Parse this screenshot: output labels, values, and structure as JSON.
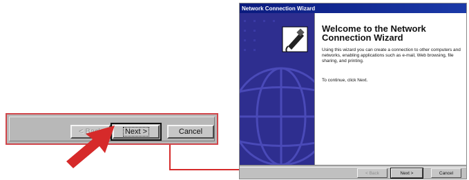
{
  "zoom_strip": {
    "back_label": "< Back",
    "next_label": "Next >",
    "cancel_label": "Cancel"
  },
  "wizard": {
    "window_title": "Network Connection Wizard",
    "heading": "Welcome to the Network Connection Wizard",
    "description": "Using this wizard you can create a connection to other computers and networks, enabling applications such as e-mail, Web browsing, file sharing, and printing.",
    "continue_text": "To continue, click Next.",
    "back_label": "< Back",
    "next_label": "Next >",
    "cancel_label": "Cancel"
  },
  "colors": {
    "annotation_red": "#d62a2a",
    "titlebar_blue": "#0a1a7e",
    "sidebar_indigo": "#2e2e8f",
    "dialog_gray": "#c0c0c0"
  },
  "icons": {
    "wizard_icon": "network-cable-plug-icon",
    "sidebar_art": "globe-art"
  }
}
